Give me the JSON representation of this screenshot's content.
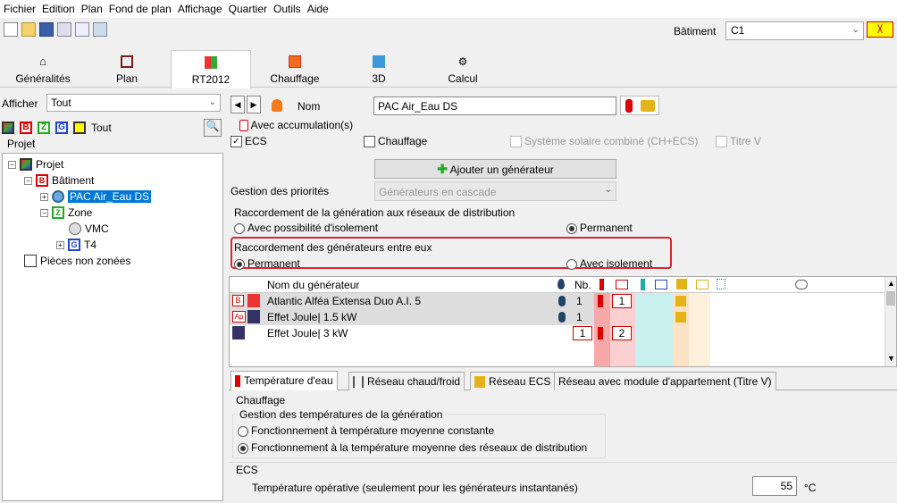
{
  "menu": [
    "Fichier",
    "Edition",
    "Plan",
    "Fond de plan",
    "Affichage",
    "Quartier",
    "Outils",
    "Aide"
  ],
  "toolbar": {
    "icons": [
      "new-file-icon",
      "open-folder-icon",
      "save-icon",
      "list-icon",
      "network-icon",
      "table-icon"
    ]
  },
  "batiment": {
    "label": "Bâtiment",
    "value": "C1"
  },
  "main_tabs": [
    {
      "label": "Généralités",
      "icon": "home-icon"
    },
    {
      "label": "Plan",
      "icon": "plan-icon"
    },
    {
      "label": "RT2012",
      "icon": "rt2012-icon",
      "active": true
    },
    {
      "label": "Chauffage",
      "icon": "heating-house-icon"
    },
    {
      "label": "3D",
      "icon": "cube-icon"
    },
    {
      "label": "Calcul",
      "icon": "gears-icon"
    }
  ],
  "left": {
    "afficher_label": "Afficher",
    "afficher_value": "Tout",
    "filters": {
      "b": "B",
      "z": "Z",
      "g": "G",
      "tout": "Tout"
    },
    "projet_header": "Projet",
    "tree": {
      "projet": "Projet",
      "batiment": "Bâtiment",
      "pac": "PAC Air_Eau DS",
      "zone": "Zone",
      "vmc": "VMC",
      "t4": "T4",
      "pieces": "Pièces non zonées"
    }
  },
  "generator": {
    "nom_label": "Nom",
    "nom_value": "PAC Air_Eau DS",
    "avec_accumulation": "Avec accumulation(s)",
    "ecs": "ECS",
    "chauffage": "Chauffage",
    "solaire": "Système solaire combiné (CH+ECS)",
    "titre_v": "Titre V",
    "add_button": "Ajouter un générateur",
    "gestion_label": "Gestion des priorités",
    "gestion_value": "Générateurs en cascade",
    "raccord_distrib_title": "Raccordement de la génération aux réseaux de distribution",
    "raccord_distrib_opt1": "Avec possibilité d'isolement",
    "raccord_distrib_opt2": "Permanent",
    "raccord_gen_title": "Raccordement des générateurs entre eux",
    "raccord_gen_opt1": "Permanent",
    "raccord_gen_opt2": "Avec isolement"
  },
  "grid": {
    "headers": {
      "nom": "Nom du générateur",
      "nb": "Nb."
    },
    "rows": [
      {
        "badge": "B",
        "name": "Atlantic Alféa Extensa Duo A.I. 5",
        "nb": "1",
        "val2": "1"
      },
      {
        "badge": "Ap",
        "name": "Effet Joule| 1.5 kW",
        "nb": "1"
      },
      {
        "badge": "",
        "name": "Effet Joule| 3 kW",
        "val1": "1",
        "val2": "2"
      }
    ]
  },
  "bottom_tabs": [
    "Température d'eau",
    "Réseau chaud/froid",
    "Réseau ECS",
    "Réseau avec module d'appartement (Titre V)"
  ],
  "bottom": {
    "chauffage": "Chauffage",
    "gestion_title": "Gestion des températures de la génération",
    "opt1": "Fonctionnement à température moyenne constante",
    "opt2": "Fonctionnement à la température moyenne des réseaux de distribution",
    "ecs": "ECS",
    "temp_label": "Température opérative (seulement pour les générateurs instantanés)",
    "temp_value": "55",
    "temp_unit": "°C"
  },
  "colors": {
    "highlight_red": "#d9262f",
    "selection_blue": "#0078d7",
    "col_red": "#f7a8a8",
    "col_cyan": "#c8f0ef",
    "col_tan": "#fbe2c4"
  }
}
